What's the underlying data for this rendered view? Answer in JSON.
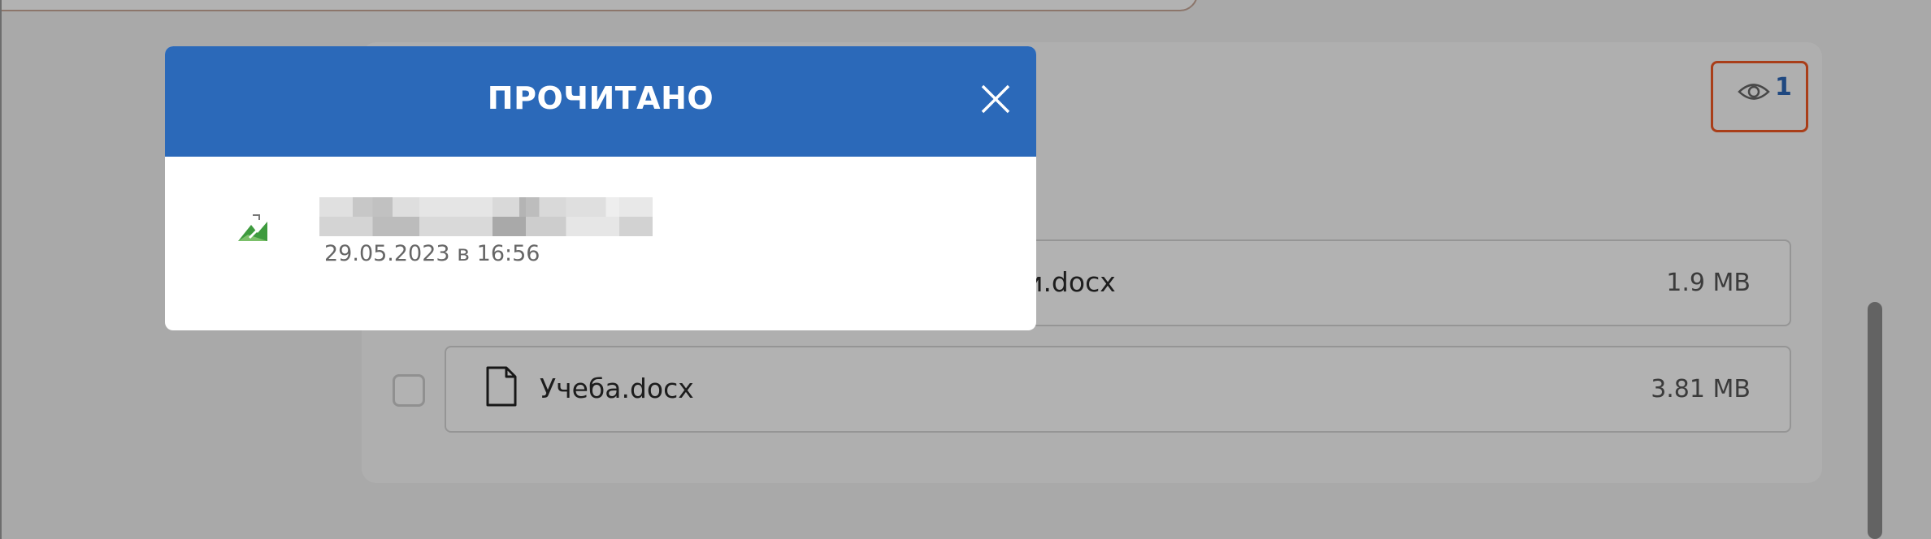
{
  "modal": {
    "title": "ПРОЧИТАНО",
    "readers": [
      {
        "name": "",
        "date": "29.05.2023 в 16:56"
      }
    ]
  },
  "read_indicator": {
    "icon": "eye-icon",
    "count": "1"
  },
  "files": [
    {
      "name_visible": "и.docx",
      "size": "1.9 MB"
    },
    {
      "name_visible": "Учеба.docx",
      "size": "3.81 MB"
    }
  ],
  "colors": {
    "header_blue": "#2b69b9",
    "highlight_orange": "#f25a25",
    "count_blue": "#2d67b8"
  }
}
